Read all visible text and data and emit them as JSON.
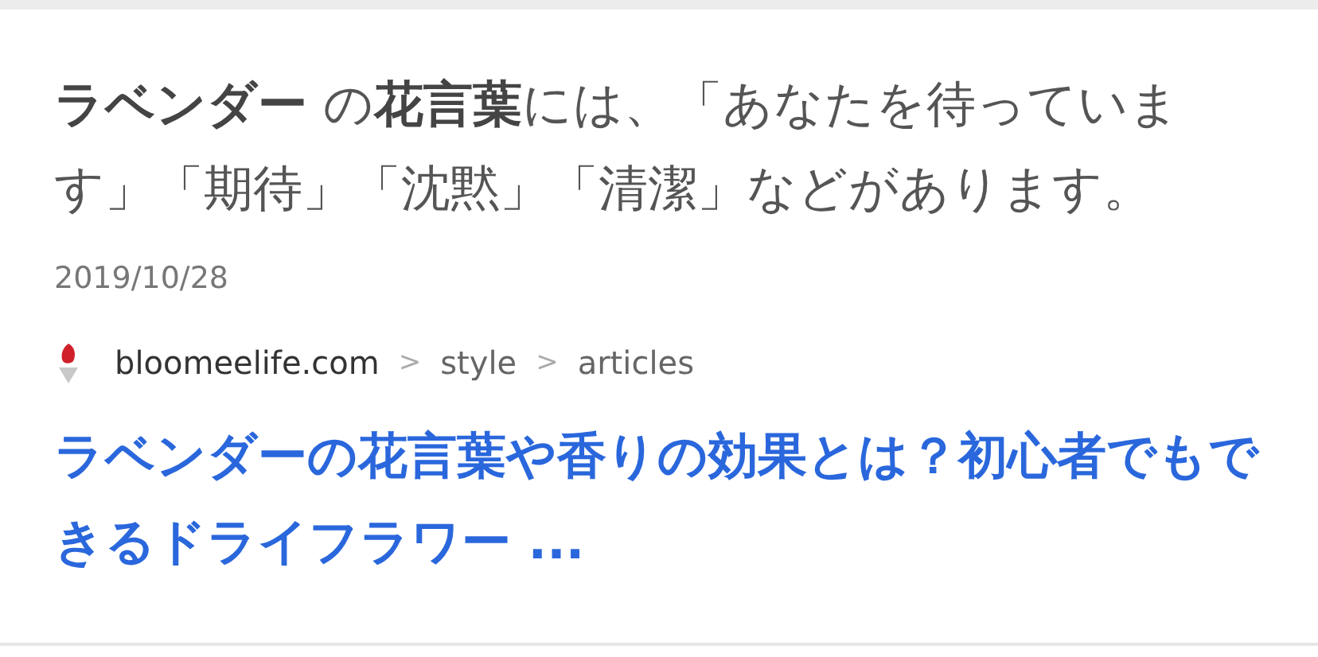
{
  "snippet": "**ラベンダー** の**花言葉**には、「あなたを待っています」「期待」「沈黙」「清潔」などがあります。",
  "date": "2019/10/28",
  "breadcrumb": [
    {
      "text": "bloomeelife.com"
    },
    {
      "text": "style"
    },
    {
      "text": "articles"
    }
  ],
  "separators": [
    ">",
    ">"
  ],
  "title": "ラベンダーの花言葉や香りの効果とは？初心者でもできるドライフラワー ..."
}
